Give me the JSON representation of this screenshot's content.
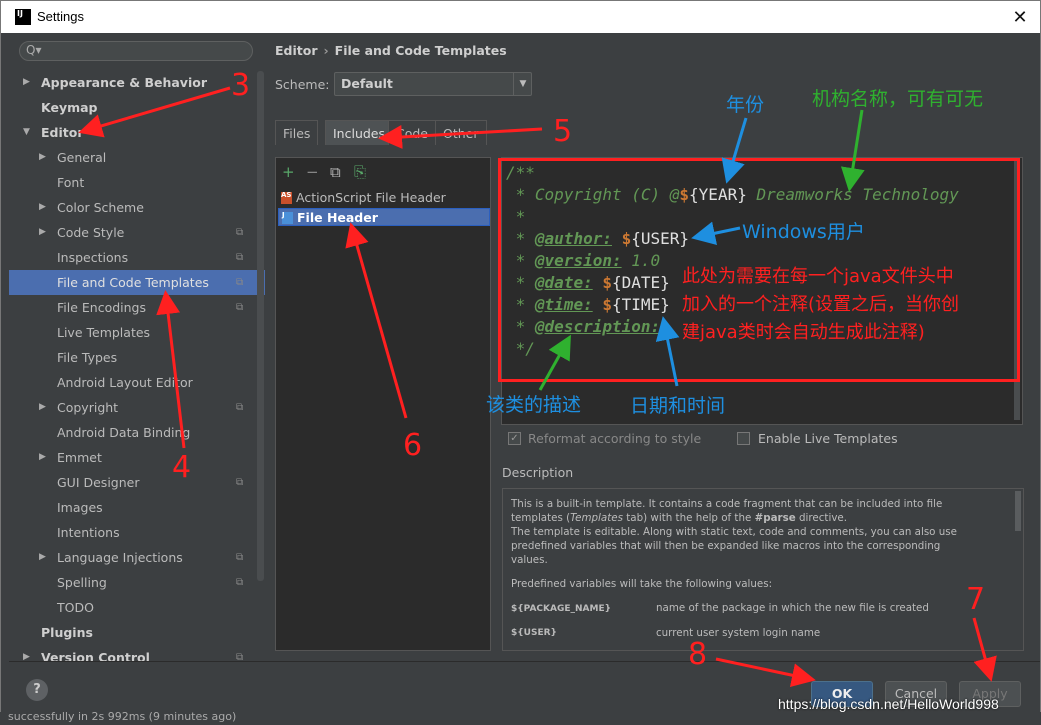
{
  "window": {
    "title": "Settings",
    "app_icon_text": "IJ",
    "close_glyph": "✕"
  },
  "sidebar": {
    "search_placeholder": "Q▾",
    "items": [
      {
        "label": "Appearance & Behavior",
        "bold": true,
        "arrow": "▶",
        "level": 0
      },
      {
        "label": "Keymap",
        "bold": true,
        "level": 0
      },
      {
        "label": "Editor",
        "bold": true,
        "arrow": "▼",
        "level": 0
      },
      {
        "label": "General",
        "arrow": "▶",
        "level": 1
      },
      {
        "label": "Font",
        "level": 1
      },
      {
        "label": "Color Scheme",
        "arrow": "▶",
        "level": 1
      },
      {
        "label": "Code Style",
        "arrow": "▶",
        "level": 1,
        "copy": true
      },
      {
        "label": "Inspections",
        "level": 1,
        "copy": true
      },
      {
        "label": "File and Code Templates",
        "level": 1,
        "copy": true,
        "selected": true
      },
      {
        "label": "File Encodings",
        "level": 1,
        "copy": true
      },
      {
        "label": "Live Templates",
        "level": 1
      },
      {
        "label": "File Types",
        "level": 1
      },
      {
        "label": "Android Layout Editor",
        "level": 1
      },
      {
        "label": "Copyright",
        "arrow": "▶",
        "level": 1,
        "copy": true
      },
      {
        "label": "Android Data Binding",
        "level": 1
      },
      {
        "label": "Emmet",
        "arrow": "▶",
        "level": 1
      },
      {
        "label": "GUI Designer",
        "level": 1,
        "copy": true
      },
      {
        "label": "Images",
        "level": 1
      },
      {
        "label": "Intentions",
        "level": 1
      },
      {
        "label": "Language Injections",
        "arrow": "▶",
        "level": 1,
        "copy": true
      },
      {
        "label": "Spelling",
        "level": 1,
        "copy": true
      },
      {
        "label": "TODO",
        "level": 1
      },
      {
        "label": "Plugins",
        "bold": true,
        "level": 0
      },
      {
        "label": "Version Control",
        "bold": true,
        "arrow": "▶",
        "level": 0,
        "copy": true
      }
    ]
  },
  "breadcrumb": {
    "part1": "Editor",
    "sep": "›",
    "part2": "File and Code Templates"
  },
  "scheme": {
    "label": "Scheme:",
    "value": "Default"
  },
  "tabs": [
    "Files",
    "Includes",
    "Code",
    "Other"
  ],
  "template_toolbar": {
    "add": "+",
    "remove": "−",
    "copy": "⧉",
    "reset": "⎘"
  },
  "templates": [
    {
      "name": "ActionScript File Header",
      "icon": "AS"
    },
    {
      "name": "File Header",
      "icon": "J",
      "selected": true
    }
  ],
  "editor_lines": [
    "/**",
    " * Copyright (C) @",
    " *",
    " * ",
    " * ",
    " * ",
    " * ",
    " * ",
    " */"
  ],
  "code": {
    "l1": "/**",
    "l2a": " * Copyright (C) @",
    "l2b": "YEAR",
    "l2c": " Dreamworks Technology",
    "l3": " *",
    "l4a": " * ",
    "l4tag": "@author:",
    "l4b": "USER",
    "l5a": " * ",
    "l5tag": "@version:",
    "l5b": " 1.0",
    "l6a": " * ",
    "l6tag": "@date:",
    "l6b": "DATE",
    "l7a": " * ",
    "l7tag": "@time:",
    "l7b": "TIME",
    "l8a": " * ",
    "l8tag": "@description:",
    "l9": " */",
    "dollar": "$",
    "lb": "{",
    "rb": "}"
  },
  "options": {
    "reformat": "Reformat according to style",
    "live": "Enable Live Templates"
  },
  "description": {
    "title": "Description",
    "p1a": "This is a built-in template. It contains a code fragment that can be included into file",
    "p1b": "templates (",
    "p1c": "Templates",
    "p1d": " tab) with the help of the ",
    "p1e": "#parse",
    "p1f": " directive.",
    "p2": "The template is editable. Along with static text, code and comments, you can also use",
    "p3": "predefined variables that will then be expanded like macros into the corresponding",
    "p4": "values.",
    "p5": "Predefined variables will take the following values:",
    "vars": [
      {
        "name": "${PACKAGE_NAME}",
        "desc": "name of the package in which the new file is created"
      },
      {
        "name": "${USER}",
        "desc": "current user system login name"
      }
    ]
  },
  "buttons": {
    "help": "?",
    "ok": "OK",
    "cancel": "Cancel",
    "apply": "Apply"
  },
  "annotations": {
    "n3": "3",
    "n4": "4",
    "n5": "5",
    "n6": "6",
    "n7": "7",
    "n8": "8",
    "year": "年份",
    "org": "机构名称，可有可无",
    "windows_user": "Windows用户",
    "note1": "此处为需要在每一个java文件头中",
    "note2": "加入的一个注释(设置之后，当你创",
    "note3": "建java类时会自动生成此注释)",
    "class_desc": "该类的描述",
    "datetime": "日期和时间"
  },
  "watermark": "https://blog.csdn.net/HelloWorld998",
  "statusbar": "successfully in 2s 992ms (9 minutes ago)"
}
